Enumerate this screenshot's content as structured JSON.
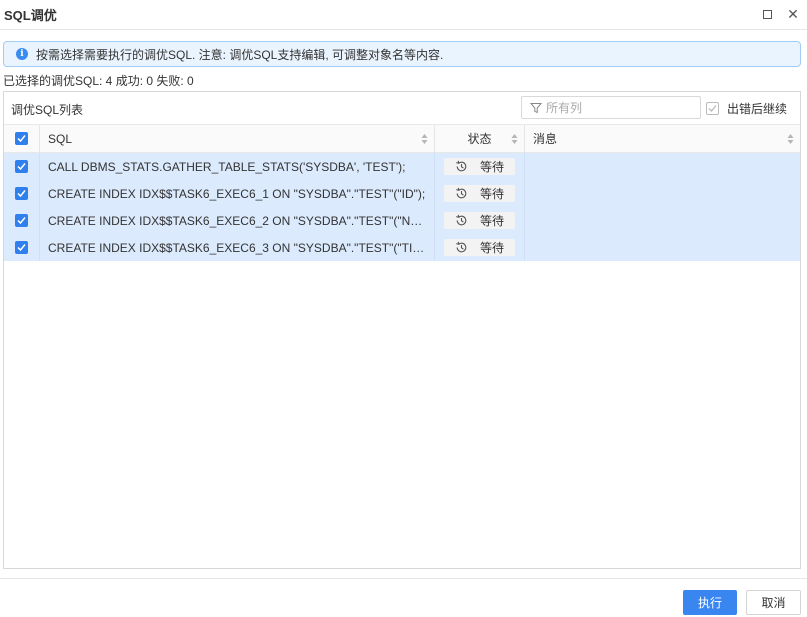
{
  "window": {
    "title": "SQL调优",
    "maximize_icon": "maximize-icon",
    "close_glyph": "✕"
  },
  "info": {
    "icon": "info-icon",
    "icon_glyph": "i",
    "text": "按需选择需要执行的调优SQL. 注意: 调优SQL支持编辑, 可调整对象名等内容."
  },
  "summary": "已选择的调优SQL: 4 成功: 0 失败: 0",
  "panel": {
    "title": "调优SQL列表",
    "filter_placeholder": "所有列",
    "continue_on_error": {
      "label": "出错后继续",
      "checked": false
    }
  },
  "table": {
    "columns": {
      "sql": "SQL",
      "status": "状态",
      "message": "消息"
    },
    "select_all": true,
    "rows": [
      {
        "checked": true,
        "sql": "CALL DBMS_STATS.GATHER_TABLE_STATS('SYSDBA', 'TEST');",
        "status": "等待",
        "message": ""
      },
      {
        "checked": true,
        "sql": "CREATE INDEX IDX$$TASK6_EXEC6_1 ON \"SYSDBA\".\"TEST\"(\"ID\");",
        "status": "等待",
        "message": ""
      },
      {
        "checked": true,
        "sql": "CREATE INDEX IDX$$TASK6_EXEC6_2 ON \"SYSDBA\".\"TEST\"(\"NA...",
        "status": "等待",
        "message": ""
      },
      {
        "checked": true,
        "sql": "CREATE INDEX IDX$$TASK6_EXEC6_3 ON \"SYSDBA\".\"TEST\"(\"TIM...",
        "status": "等待",
        "message": ""
      }
    ]
  },
  "buttons": {
    "execute": "执行",
    "cancel": "取消"
  },
  "colors": {
    "accent": "#3a86f0",
    "row_selected": "#dbeafd",
    "info_bg": "#eaf4fe"
  }
}
